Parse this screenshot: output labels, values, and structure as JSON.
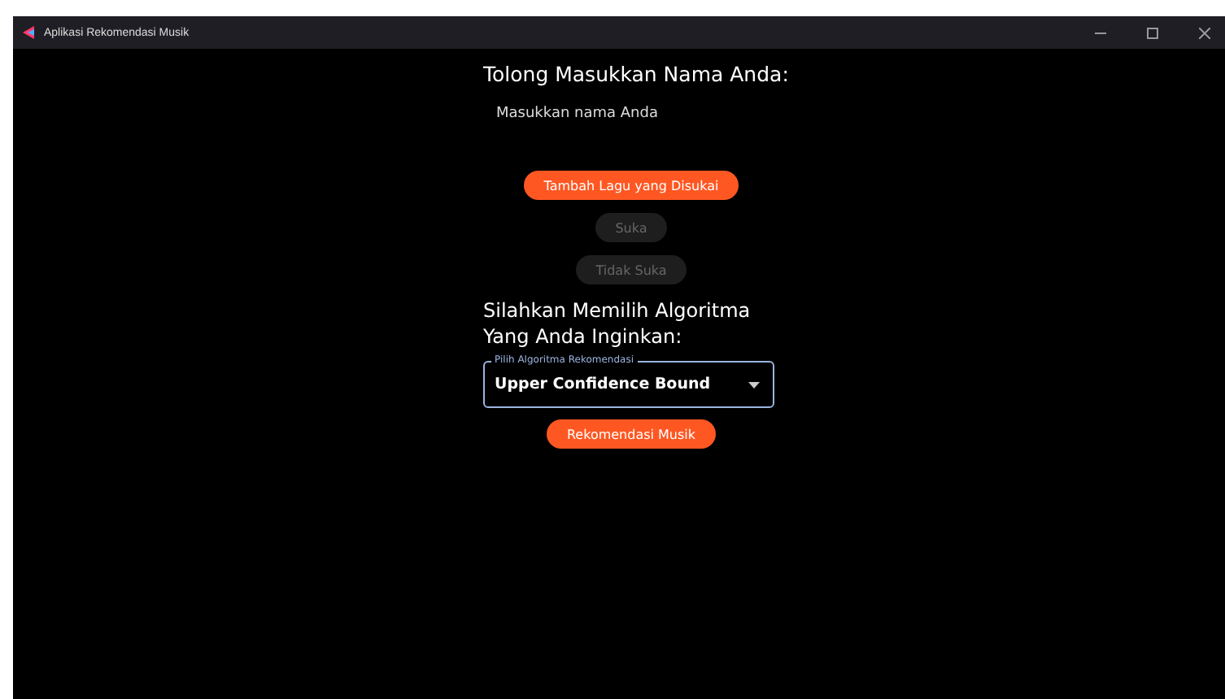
{
  "window": {
    "title": "Aplikasi Rekomendasi Musik"
  },
  "name_prompt": "Tolong Masukkan Nama Anda:",
  "name_field": {
    "placeholder": "Masukkan nama Anda"
  },
  "buttons": [
    {
      "label": "Tambah Lagu yang Disukai",
      "disabled": false
    },
    {
      "label": "Suka",
      "disabled": true
    },
    {
      "label": "Tidak Suka",
      "disabled": true
    }
  ],
  "algorithm_prompt": "Silahkan Memilih Algoritma Yang Anda Inginkan:",
  "algorithm_select": {
    "label": "Pilih Algoritma Rekomendasi",
    "value": "Upper Confidence Bound"
  },
  "submit_button": {
    "label": "Rekomendasi Musik",
    "disabled": false
  }
}
